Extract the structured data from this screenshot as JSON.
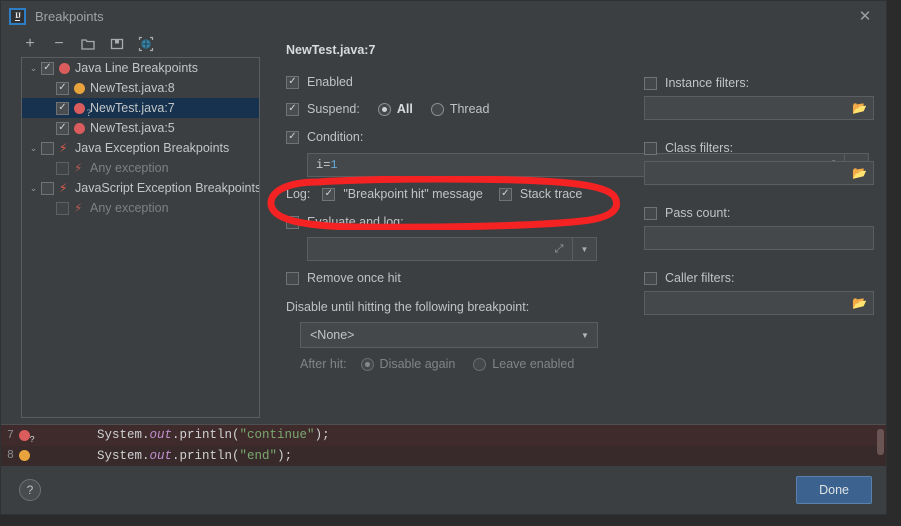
{
  "window": {
    "title": "Breakpoints",
    "logo_icon": "intellij-idea-logo-icon",
    "close_icon": "close-icon"
  },
  "toolbar": {
    "items": [
      {
        "name": "add-breakpoint-button",
        "icon": "plus-icon",
        "glyph": "+"
      },
      {
        "name": "remove-breakpoint-button",
        "icon": "minus-icon",
        "glyph": "−"
      },
      {
        "name": "open-group-button",
        "icon": "folder-open-icon",
        "glyph": "◨"
      },
      {
        "name": "save-group-button",
        "icon": "folder-save-icon",
        "glyph": "◧"
      },
      {
        "name": "view-breakpoints-button",
        "icon": "target-circle-icon",
        "glyph": "◉"
      }
    ]
  },
  "tree": {
    "nodes": [
      {
        "twisty": "⌄",
        "indent": 0,
        "checked": true,
        "dim": false,
        "marker": "breakpoint-dot-red",
        "label": "Java Line Breakpoints",
        "selected": false
      },
      {
        "twisty": "",
        "indent": 1,
        "checked": true,
        "dim": false,
        "marker": "breakpoint-dot-amber",
        "label": "NewTest.java:8",
        "selected": false
      },
      {
        "twisty": "",
        "indent": 1,
        "checked": true,
        "dim": false,
        "marker": "breakpoint-dot-red-question",
        "label": "NewTest.java:7",
        "selected": true
      },
      {
        "twisty": "",
        "indent": 1,
        "checked": true,
        "dim": false,
        "marker": "breakpoint-dot-red",
        "label": "NewTest.java:5",
        "selected": false
      },
      {
        "twisty": "⌄",
        "indent": 0,
        "checked": false,
        "dim": false,
        "marker": "lightning-bolt-icon",
        "label": "Java Exception Breakpoints",
        "selected": false
      },
      {
        "twisty": "",
        "indent": 1,
        "checked": false,
        "dim": true,
        "marker": "lightning-bolt-icon",
        "label": "Any exception",
        "selected": false
      },
      {
        "twisty": "⌄",
        "indent": 0,
        "checked": false,
        "dim": false,
        "marker": "lightning-bolt-icon",
        "label": "JavaScript Exception Breakpoints",
        "selected": false
      },
      {
        "twisty": "",
        "indent": 1,
        "checked": false,
        "dim": true,
        "marker": "lightning-bolt-icon",
        "label": "Any exception",
        "selected": false
      }
    ]
  },
  "details": {
    "title": "NewTest.java:7",
    "enabled": {
      "label": "Enabled",
      "checked": true
    },
    "suspend": {
      "label": "Suspend:",
      "checked": true,
      "options": [
        {
          "label": "All",
          "selected": true
        },
        {
          "label": "Thread",
          "selected": false
        }
      ]
    },
    "condition": {
      "label": "Condition:",
      "checked": true,
      "value": "i=1",
      "value_var": "i=",
      "value_num": "1",
      "placeholder": "",
      "expand_icon": "expand-diagonal-icon",
      "dropdown_icon": "chevron-down-icon"
    },
    "log": {
      "label": "Log:",
      "options": [
        {
          "label": "\"Breakpoint hit\" message",
          "checked": true
        },
        {
          "label": "Stack trace",
          "checked": true
        }
      ]
    },
    "evaluate_and_log": {
      "label": "Evaluate and log:",
      "checked": false,
      "value": "",
      "placeholder": "",
      "expand_icon": "expand-diagonal-icon",
      "dropdown_icon": "chevron-down-icon"
    },
    "remove_once_hit": {
      "label": "Remove once hit",
      "checked": false
    },
    "disable_until": {
      "label": "Disable until hitting the following breakpoint:",
      "selected_value": "<None>",
      "dropdown_icon": "chevron-down-icon"
    },
    "after_hit": {
      "label": "After hit:",
      "disabled": true,
      "options": [
        {
          "label": "Disable again",
          "selected": true
        },
        {
          "label": "Leave enabled",
          "selected": false
        }
      ]
    },
    "filters": [
      {
        "name": "instance-filters",
        "label": "Instance filters:",
        "checked": false,
        "value": "",
        "has_folder": true
      },
      {
        "name": "class-filters",
        "label": "Class filters:",
        "checked": false,
        "value": "",
        "has_folder": true
      },
      {
        "name": "pass-count",
        "label": "Pass count:",
        "checked": false,
        "value": "",
        "has_folder": false
      },
      {
        "name": "caller-filters",
        "label": "Caller filters:",
        "checked": false,
        "value": "",
        "has_folder": true
      }
    ]
  },
  "code_preview": {
    "lines": [
      {
        "number": "7",
        "marker": "breakpoint-dot-red-question",
        "plain1": "System.",
        "field": "out",
        "plain2": ".println(",
        "string": "\"continue\"",
        "plain3": ");"
      },
      {
        "number": "8",
        "marker": "breakpoint-dot-amber",
        "plain1": "System.",
        "field": "out",
        "plain2": ".println(",
        "string": "\"end\"",
        "plain3": ");"
      }
    ]
  },
  "footer": {
    "help_label": "?",
    "help_icon": "question-mark-icon",
    "done_label": "Done"
  },
  "annotation": {
    "shape": "red-ellipse-highlight",
    "color": "#f42222"
  }
}
